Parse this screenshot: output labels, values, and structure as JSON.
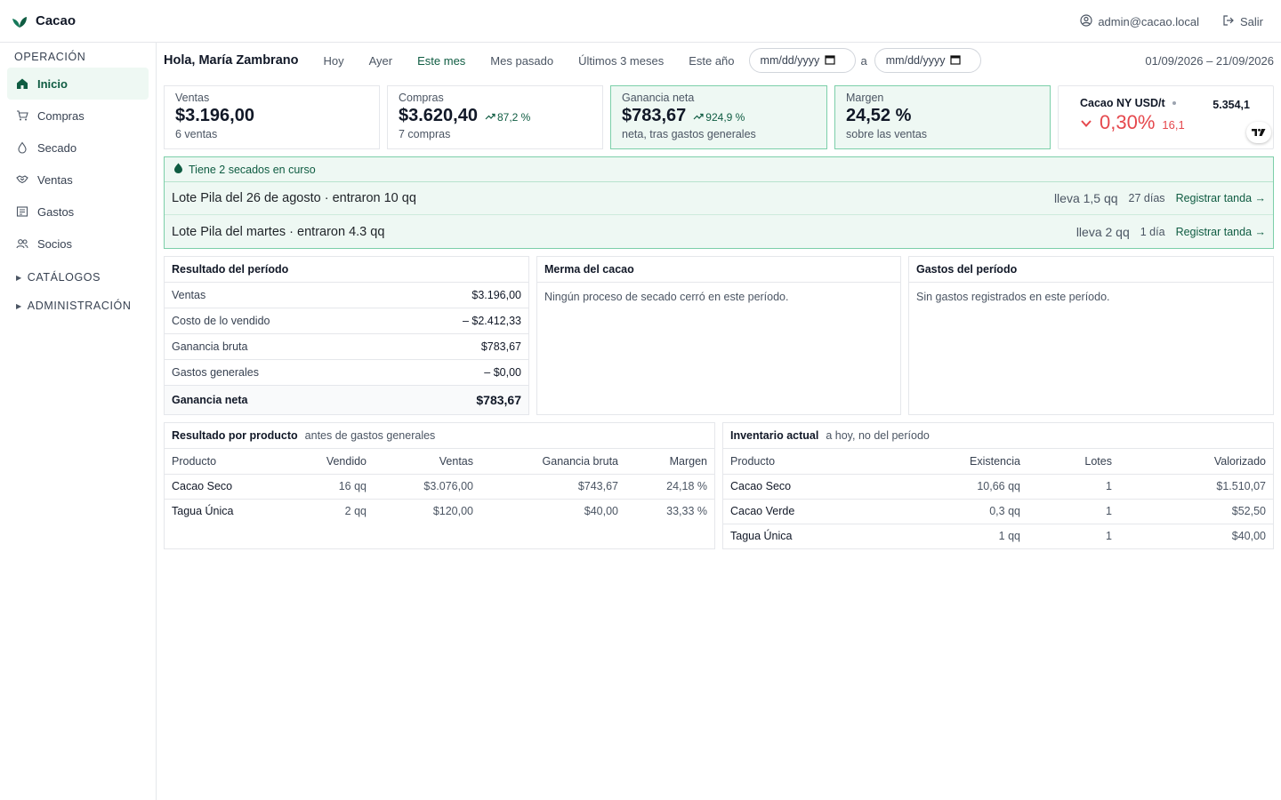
{
  "app": {
    "name": "Cacao",
    "logo_icon": "leaf-icon"
  },
  "header": {
    "user_email": "admin@cacao.local",
    "logout_label": "Salir"
  },
  "sidebar": {
    "operacion_title": "OPERACIÓN",
    "items": [
      {
        "label": "Inicio",
        "icon": "home-icon",
        "active": true
      },
      {
        "label": "Compras",
        "icon": "cart-icon"
      },
      {
        "label": "Secado",
        "icon": "drop-icon"
      },
      {
        "label": "Ventas",
        "icon": "handshake-icon"
      },
      {
        "label": "Gastos",
        "icon": "receipt-icon"
      },
      {
        "label": "Socios",
        "icon": "users-icon"
      }
    ],
    "catalogos_label": "CATÁLOGOS",
    "administracion_label": "ADMINISTRACIÓN"
  },
  "filters": {
    "greeting": "Hola, María Zambrano",
    "periods": [
      "Hoy",
      "Ayer",
      "Este mes",
      "Mes pasado",
      "Últimos 3 meses",
      "Este año"
    ],
    "active_period": "Este mes",
    "date_placeholder": "mm/dd/yyyy",
    "date_separator": "a",
    "range_text": "01/09/2026 – 21/09/2026"
  },
  "kpis": {
    "ventas": {
      "label": "Ventas",
      "value": "$3.196,00",
      "sub": "6 ventas"
    },
    "compras": {
      "label": "Compras",
      "value": "$3.620,40",
      "change": "87,2 %",
      "sub": "7 compras"
    },
    "ganancia": {
      "label": "Ganancia neta",
      "value": "$783,67",
      "change": "924,9 %",
      "sub": "neta, tras gastos generales"
    },
    "margen": {
      "label": "Margen",
      "value": "24,52 %",
      "sub": "sobre las ventas"
    }
  },
  "ticker": {
    "name": "Cacao NY USD/t",
    "price": "5.354,1",
    "change_pct": "0,30%",
    "change_abs": "16,1",
    "badge": "TV"
  },
  "drying": {
    "header": "Tiene 2 secados en curso",
    "rows": [
      {
        "title": "Lote Pila del 26 de agosto · entraron 10 qq",
        "carry": "lleva 1,5 qq",
        "days": "27 días",
        "action": "Registrar tanda →"
      },
      {
        "title": "Lote Pila del martes · entraron 4.3 qq",
        "carry": "lleva 2 qq",
        "days": "1 día",
        "action": "Registrar tanda →"
      }
    ]
  },
  "resultado": {
    "title": "Resultado del período",
    "rows": [
      {
        "label": "Ventas",
        "value": "$3.196,00"
      },
      {
        "label": "Costo de lo vendido",
        "value": "– $2.412,33"
      },
      {
        "label": "Ganancia bruta",
        "value": "$783,67"
      },
      {
        "label": "Gastos generales",
        "value": "– $0,00"
      }
    ],
    "total_label": "Ganancia neta",
    "total_value": "$783,67"
  },
  "merma": {
    "title": "Merma del cacao",
    "empty": "Ningún proceso de secado cerró en este período."
  },
  "gastos": {
    "title": "Gastos del período",
    "empty": "Sin gastos registrados en este período."
  },
  "producto": {
    "title": "Resultado por producto",
    "note": "antes de gastos generales",
    "headers": [
      "Producto",
      "Vendido",
      "Ventas",
      "Ganancia bruta",
      "Margen"
    ],
    "rows": [
      [
        "Cacao Seco",
        "16 qq",
        "$3.076,00",
        "$743,67",
        "24,18 %"
      ],
      [
        "Tagua Única",
        "2 qq",
        "$120,00",
        "$40,00",
        "33,33 %"
      ]
    ]
  },
  "inventario": {
    "title": "Inventario actual",
    "note": "a hoy, no del período",
    "headers": [
      "Producto",
      "Existencia",
      "Lotes",
      "Valorizado"
    ],
    "rows": [
      [
        "Cacao Seco",
        "10,66 qq",
        "1",
        "$1.510,07"
      ],
      [
        "Cacao Verde",
        "0,3 qq",
        "1",
        "$52,50"
      ],
      [
        "Tagua Única",
        "1 qq",
        "1",
        "$40,00"
      ]
    ]
  },
  "colors": {
    "accent": "#0f5c42",
    "highlight_bg": "#eef8f3",
    "highlight_border": "#7ccfa9",
    "negative": "#e5484d"
  }
}
